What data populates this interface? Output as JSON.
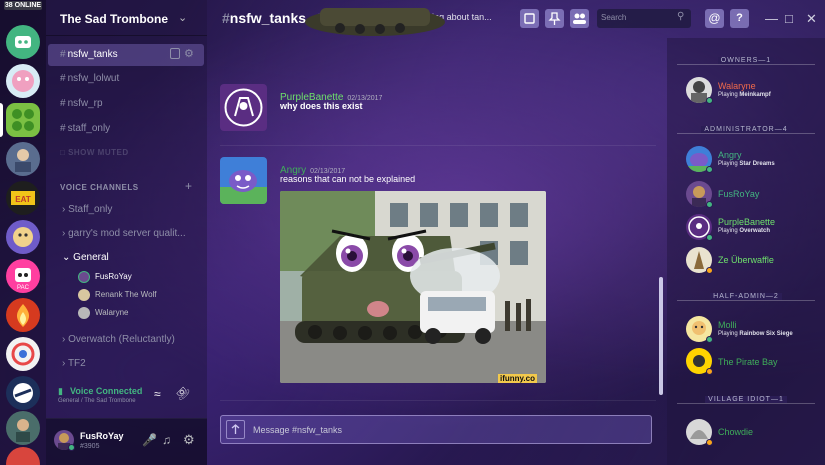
{
  "rail": {
    "online_count": "38 ONLINE",
    "servers": [
      {
        "name": "server-1",
        "color": "#43b581"
      },
      {
        "name": "server-2",
        "color": "#c7e3f0"
      },
      {
        "name": "server-3",
        "color": "#7ab84b"
      },
      {
        "name": "server-4",
        "color": "#5a6d8f"
      },
      {
        "name": "server-5",
        "color": "#2a2a2a"
      },
      {
        "name": "server-6",
        "color": "#6f5cc9"
      },
      {
        "name": "server-7",
        "color": "#ff3fa0"
      },
      {
        "name": "server-8",
        "color": "#ff8a3d"
      },
      {
        "name": "server-9",
        "color": "#e84848"
      },
      {
        "name": "server-10",
        "color": "#1c2f5a"
      },
      {
        "name": "server-11",
        "color": "#4a6d6a"
      },
      {
        "name": "server-12",
        "color": "#d8453d"
      }
    ]
  },
  "guild": {
    "name": "The Sad Trombone"
  },
  "channels": {
    "text": [
      {
        "label": "nsfw_tanks",
        "selected": true
      },
      {
        "label": "nsfw_lolwut"
      },
      {
        "label": "nsfw_rp"
      },
      {
        "label": "staff_only"
      }
    ],
    "show_muted": "SHOW MUTED",
    "voice_header": "VOICE CHANNELS",
    "voice": [
      {
        "label": "Staff_only"
      },
      {
        "label": "garry's mod server qualit..."
      },
      {
        "label": "General",
        "expanded": true
      },
      {
        "label": "Overwatch (Reluctantly)"
      },
      {
        "label": "TF2"
      }
    ],
    "general_users": [
      "FusRoYay",
      "Renank The Wolf",
      "Walaryne"
    ]
  },
  "voice_status": {
    "title": "Voice Connected",
    "subtitle": "General / The Sad Trombone"
  },
  "user": {
    "name": "FusRoYay",
    "tag": "#3905"
  },
  "header": {
    "channel": "nsfw_tanks",
    "topic": "Because the admins like talking about tan...",
    "search_placeholder": "Search"
  },
  "messages": [
    {
      "author": "PurpleBanette",
      "author_color": "#6ee06b",
      "time": "02/13/2017",
      "text": "why does this exist"
    },
    {
      "author": "Angry",
      "author_color": "#3fae5a",
      "time": "02/13/2017",
      "text": "reasons that can not be explained",
      "image_caption": "ifunny.co"
    }
  ],
  "composer": {
    "placeholder": "Message #nsfw_tanks"
  },
  "members": {
    "groups": [
      {
        "role": "OWNERS—1",
        "members": [
          {
            "name": "Walaryne",
            "color": "#f06a4b",
            "status": "online",
            "playing": "Playing",
            "game": "Meinkampf"
          }
        ]
      },
      {
        "role": "ADMINISTRATOR—4",
        "members": [
          {
            "name": "Angry",
            "color": "#43b581",
            "status": "online",
            "playing": "Playing",
            "game": "Star Dreams"
          },
          {
            "name": "FusRoYay",
            "color": "#43b581",
            "status": "online",
            "playing": "",
            "game": ""
          },
          {
            "name": "PurpleBanette",
            "color": "#6ee06b",
            "status": "online",
            "playing": "Playing",
            "game": "Overwatch"
          },
          {
            "name": "Ze Überwaffle",
            "color": "#6ee06b",
            "status": "idle",
            "playing": "",
            "game": ""
          }
        ]
      },
      {
        "role": "HALF-ADMIN—2",
        "members": [
          {
            "name": "Molli",
            "color": "#3fae5a",
            "status": "online",
            "playing": "Playing",
            "game": "Rainbow Six Siege"
          },
          {
            "name": "The Pirate Bay",
            "color": "#3fae5a",
            "status": "idle",
            "playing": "",
            "game": ""
          }
        ]
      },
      {
        "role": "VILLAGE IDIOT—1",
        "members": [
          {
            "name": "Chowdie",
            "color": "#3fae5a",
            "status": "idle",
            "playing": "",
            "game": ""
          }
        ]
      }
    ]
  },
  "colors": {
    "online": "#43b581",
    "idle": "#faa61a",
    "accent": "#7289da"
  }
}
